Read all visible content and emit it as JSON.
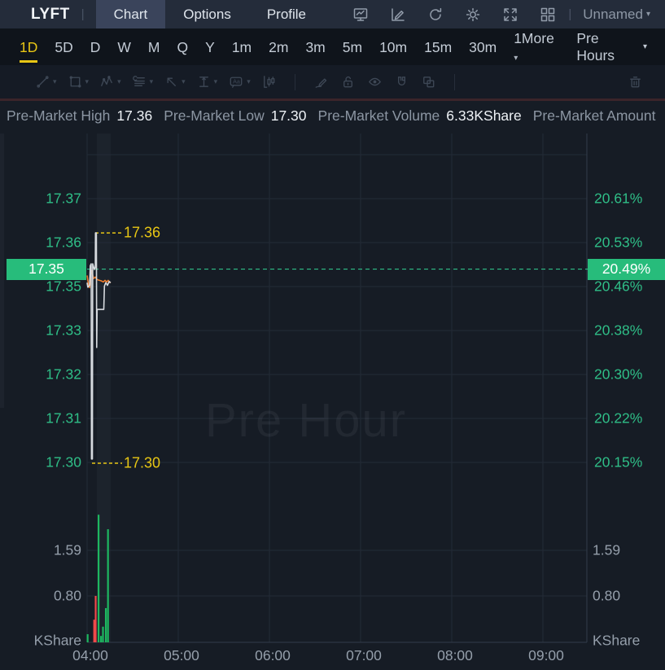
{
  "topbar": {
    "symbol": "LYFT",
    "separator": "|",
    "tabs": [
      {
        "label": "Chart",
        "active": true
      },
      {
        "label": "Options",
        "active": false
      },
      {
        "label": "Profile",
        "active": false
      }
    ],
    "icons": [
      "chart-screenshot",
      "edit-chart",
      "refresh",
      "settings",
      "fullscreen",
      "layout-grid"
    ],
    "workspace": {
      "label": "Unnamed",
      "caret": "▾"
    }
  },
  "timeframe_bar": {
    "items": [
      {
        "label": "1D",
        "active": true
      },
      {
        "label": "5D"
      },
      {
        "label": "D"
      },
      {
        "label": "W"
      },
      {
        "label": "M"
      },
      {
        "label": "Q"
      },
      {
        "label": "Y"
      },
      {
        "label": "1m"
      },
      {
        "label": "2m"
      },
      {
        "label": "3m"
      },
      {
        "label": "5m"
      },
      {
        "label": "10m"
      },
      {
        "label": "15m"
      },
      {
        "label": "30m"
      },
      {
        "label": "1More",
        "caret": "▾"
      }
    ],
    "session": {
      "label": "Pre Hours",
      "caret": "▾"
    }
  },
  "drawing_toolbar": {
    "tools": [
      "trend-line",
      "shapes",
      "wave-pattern",
      "gann-lines",
      "arrow-mark",
      "measure",
      "text-note",
      "candle-pattern",
      "brush",
      "lock",
      "visibility",
      "magnet",
      "duplicate",
      "trash"
    ],
    "text_icon_label": "Aa"
  },
  "info_bar": {
    "pairs": [
      {
        "label": "Pre-Market High",
        "value": "17.36"
      },
      {
        "label": "Pre-Market Low",
        "value": "17.30"
      },
      {
        "label": "Pre-Market Volume",
        "value": "6.33KShare"
      },
      {
        "label": "Pre-Market Amount",
        "value": ""
      }
    ]
  },
  "chart_data": {
    "type": "line",
    "symbol": "LYFT",
    "session_watermark": "Pre Hour",
    "x_axis": {
      "labels": [
        {
          "m": 0,
          "label": "04:00"
        },
        {
          "m": 60,
          "label": "05:00"
        },
        {
          "m": 120,
          "label": "06:00"
        },
        {
          "m": 180,
          "label": "07:00"
        },
        {
          "m": 240,
          "label": "08:00"
        },
        {
          "m": 300,
          "label": "09:00"
        }
      ],
      "range_minutes": [
        0,
        330
      ]
    },
    "y_axis_left": {
      "ticks": [
        {
          "label": "17.37",
          "value": 17.37
        },
        {
          "label": "17.36",
          "value": 17.36
        },
        {
          "label": "17.35",
          "value": 17.35
        },
        {
          "label": "17.33",
          "value": 17.3383
        },
        {
          "label": "17.32",
          "value": 17.3267
        },
        {
          "label": "17.31",
          "value": 17.315
        },
        {
          "label": "17.30",
          "value": 17.3
        }
      ]
    },
    "y_axis_right": {
      "ticks": [
        "20.61%",
        "20.53%",
        "20.46%",
        "20.38%",
        "20.30%",
        "20.22%",
        "20.15%"
      ]
    },
    "current": {
      "price": 17.3513,
      "price_label": "17.35",
      "pct_label": "20.49%"
    },
    "high_marker": {
      "price": 17.3609,
      "label": "17.36"
    },
    "low_marker": {
      "price": 17.3,
      "label": "17.30"
    },
    "series": {
      "price": [
        [
          0,
          17.3477
        ],
        [
          0.5,
          17.3465
        ],
        [
          1.6,
          17.347
        ],
        [
          2.1,
          17.3522
        ],
        [
          2.7,
          17.3527
        ],
        [
          2.9,
          17.3009
        ],
        [
          3.5,
          17.3009
        ],
        [
          3.7,
          17.3527
        ],
        [
          4.8,
          17.3512
        ],
        [
          5.4,
          17.3518
        ],
        [
          5.5,
          17.3609
        ],
        [
          6.1,
          17.3609
        ],
        [
          6.3,
          17.3305
        ],
        [
          6.6,
          17.3406
        ],
        [
          11.0,
          17.3406
        ],
        [
          11.4,
          17.3468
        ],
        [
          12.3,
          17.3477
        ],
        [
          13.4,
          17.347
        ],
        [
          14.5,
          17.348
        ],
        [
          15.5,
          17.3477
        ]
      ],
      "avg_price": [
        [
          0,
          17.3496
        ],
        [
          0.5,
          17.3483
        ],
        [
          1.1,
          17.3468
        ],
        [
          1.6,
          17.3464
        ],
        [
          2.1,
          17.3475
        ],
        [
          2.7,
          17.3501
        ],
        [
          3.2,
          17.3509
        ],
        [
          3.7,
          17.3497
        ],
        [
          4.3,
          17.3488
        ],
        [
          5.4,
          17.3492
        ],
        [
          6.4,
          17.3486
        ],
        [
          7.5,
          17.3484
        ],
        [
          9.1,
          17.3482
        ],
        [
          10.7,
          17.3479
        ],
        [
          11.8,
          17.3483
        ],
        [
          12.9,
          17.3479
        ],
        [
          13.9,
          17.3483
        ],
        [
          15.0,
          17.3477
        ],
        [
          15.5,
          17.3479
        ]
      ]
    },
    "volume_pane": {
      "ticks": [
        {
          "label": "1.59",
          "value": 1.59
        },
        {
          "label": "0.80",
          "value": 0.8
        }
      ],
      "unit": "KShare",
      "bars": [
        [
          0.3,
          0.14,
          "up"
        ],
        [
          4.6,
          0.39,
          "down"
        ],
        [
          5.6,
          0.8,
          "down"
        ],
        [
          7.5,
          2.2,
          "up"
        ],
        [
          9.1,
          0.11,
          "up"
        ],
        [
          10.4,
          0.27,
          "up"
        ],
        [
          12.3,
          0.59,
          "up"
        ],
        [
          13.7,
          1.95,
          "up"
        ]
      ]
    },
    "colors": {
      "up": "#1db760",
      "down": "#ef4a4a",
      "price_line": "#d6dadf",
      "avg_line": "#ef7d2e",
      "accent_green": "#2fbe87",
      "badge_green": "#27bc7b",
      "marker_yellow": "#e8c614",
      "grid": "#232b37",
      "axis_border": "#333d4b",
      "text_grey": "#959fab"
    }
  }
}
